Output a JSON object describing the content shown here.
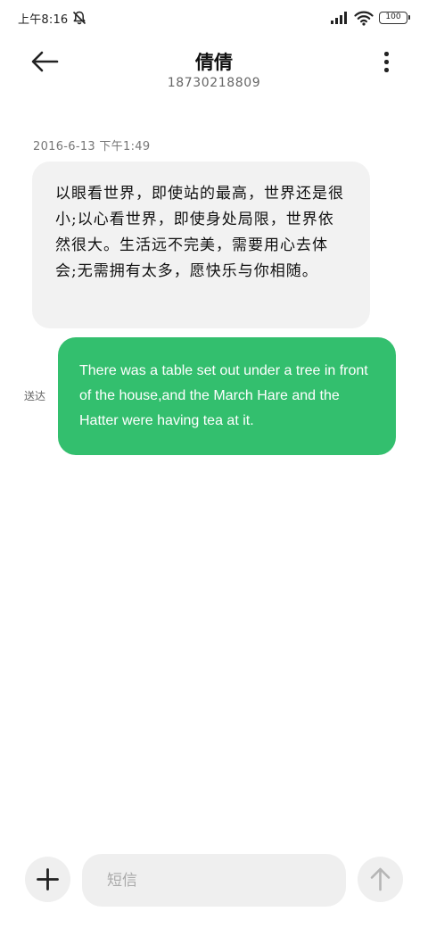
{
  "status_bar": {
    "time": "上午8:16",
    "battery": "100",
    "icons": [
      "mute-notification-icon",
      "signal-icon",
      "wifi-icon",
      "battery-icon"
    ]
  },
  "header": {
    "title": "倩倩",
    "subtitle": "18730218809",
    "icons": [
      "back-arrow-icon",
      "more-vertical-icon"
    ]
  },
  "conversation": {
    "timestamp": "2016-6-13 下午1:49",
    "messages": [
      {
        "direction": "incoming",
        "text": "以眼看世界，即使站的最高，世界还是很小;以心看世界，即使身处局限，世界依然很大。生活远不完美，需要用心去体会;无需拥有太多，愿快乐与你相随。"
      },
      {
        "direction": "outgoing",
        "status": "送达",
        "text": "There was a table set out under a tree in front of the house,and the March Hare and the Hatter were having tea at it."
      }
    ]
  },
  "composer": {
    "placeholder": "短信",
    "icons": [
      "plus-icon",
      "send-arrow-up-icon"
    ]
  },
  "colors": {
    "outgoing_bubble": "#33bf6e",
    "incoming_bubble": "#f2f2f2",
    "background": "#ffffff"
  }
}
